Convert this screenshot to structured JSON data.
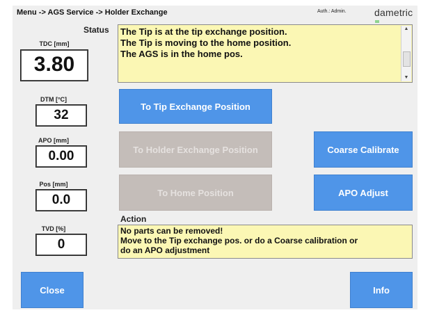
{
  "header": {
    "breadcrumb": "Menu -> AGS Service -> Holder Exchange",
    "auth": "Auth.: Admin.",
    "brand": "dametric"
  },
  "status": {
    "label": "Status",
    "lines": [
      "The Tip is at the tip exchange position.",
      "The Tip is moving to the home position.",
      "The AGS is in the home pos."
    ]
  },
  "measurements": {
    "tdc": {
      "label": "TDC [mm]",
      "value": "3.80"
    },
    "dtm": {
      "label": "DTM [°C]",
      "value": "32"
    },
    "apo": {
      "label": "APO [mm]",
      "value": "0.00"
    },
    "pos": {
      "label": "Pos [mm]",
      "value": "0.0"
    },
    "tvd": {
      "label": "TVD [%]",
      "value": "0"
    }
  },
  "buttons": {
    "tip_exchange": "To Tip Exchange Position",
    "holder_exchange": "To Holder Exchange Position",
    "home": "To Home Position",
    "coarse_calibrate": "Coarse Calibrate",
    "apo_adjust": "APO Adjust",
    "close": "Close",
    "info": "Info"
  },
  "action": {
    "label": "Action",
    "lines": [
      "No parts can be removed!",
      "Move to the Tip exchange pos. or do a Coarse calibration or",
      "do an APO adjustment"
    ]
  },
  "colors": {
    "button_blue": "#4f95e8",
    "button_disabled": "#c4bdb9",
    "textbox_yellow": "#fbf7b4",
    "panel_background": "#efefef"
  }
}
